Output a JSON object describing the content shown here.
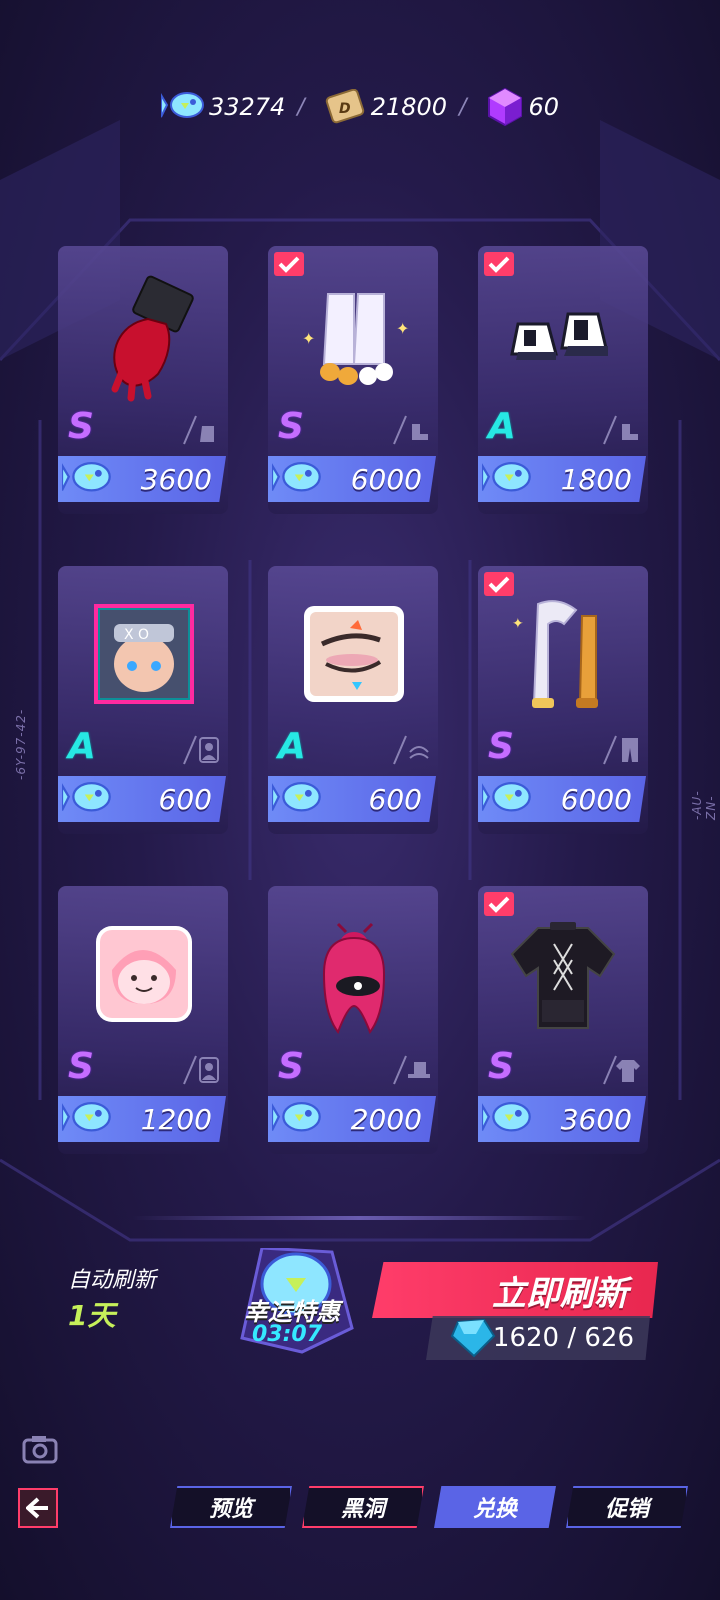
{
  "currency": [
    {
      "icon": "fish-ticket-icon",
      "value": "33274"
    },
    {
      "icon": "d-card-icon",
      "value": "21800"
    },
    {
      "icon": "purple-cube-icon",
      "value": "60"
    }
  ],
  "side_codes": {
    "left": "-6Y-97-42-",
    "right": "-AU-ZN-FL-"
  },
  "items": [
    {
      "name": "red-glove",
      "rank": "S",
      "slot": "glove-slot-icon",
      "price": "3600",
      "owned": false
    },
    {
      "name": "white-socks",
      "rank": "S",
      "slot": "shoe-slot-icon",
      "price": "6000",
      "owned": true
    },
    {
      "name": "sneakers",
      "rank": "A",
      "slot": "shoe-slot-icon",
      "price": "1800",
      "owned": true
    },
    {
      "name": "portrait-frame",
      "rank": "A",
      "slot": "avatar-slot-icon",
      "price": "600",
      "owned": false
    },
    {
      "name": "eye-makeup",
      "rank": "A",
      "slot": "makeup-slot-icon",
      "price": "600",
      "owned": false
    },
    {
      "name": "white-pants",
      "rank": "S",
      "slot": "pants-slot-icon",
      "price": "6000",
      "owned": true
    },
    {
      "name": "pink-avatar",
      "rank": "S",
      "slot": "avatar-slot-icon",
      "price": "1200",
      "owned": false
    },
    {
      "name": "pink-hair",
      "rank": "S",
      "slot": "hat-slot-icon",
      "price": "2000",
      "owned": false
    },
    {
      "name": "black-top",
      "rank": "S",
      "slot": "shirt-slot-icon",
      "price": "3600",
      "owned": true
    }
  ],
  "auto_refresh": {
    "label": "自动刷新",
    "days": "1天"
  },
  "lucky_deal": {
    "title": "幸运特惠",
    "timer": "03:07"
  },
  "refresh_button": {
    "label": "立即刷新"
  },
  "gem_cost": {
    "value": "1620 / 626"
  },
  "tabs": [
    {
      "label": "预览",
      "active": false,
      "color": "#5a64e6"
    },
    {
      "label": "黑洞",
      "active": false,
      "color": "#ff3d6a"
    },
    {
      "label": "兑换",
      "active": true,
      "color": "#5a64e6"
    },
    {
      "label": "促销",
      "active": false,
      "color": "#5a64e6"
    }
  ],
  "colors": {
    "rank_s": "#c56dff",
    "rank_a": "#27e8e4",
    "price_bar": "#5a64e6",
    "refresh": "#ff3d6a",
    "days": "#c6f05a",
    "timer": "#35e9ff"
  }
}
